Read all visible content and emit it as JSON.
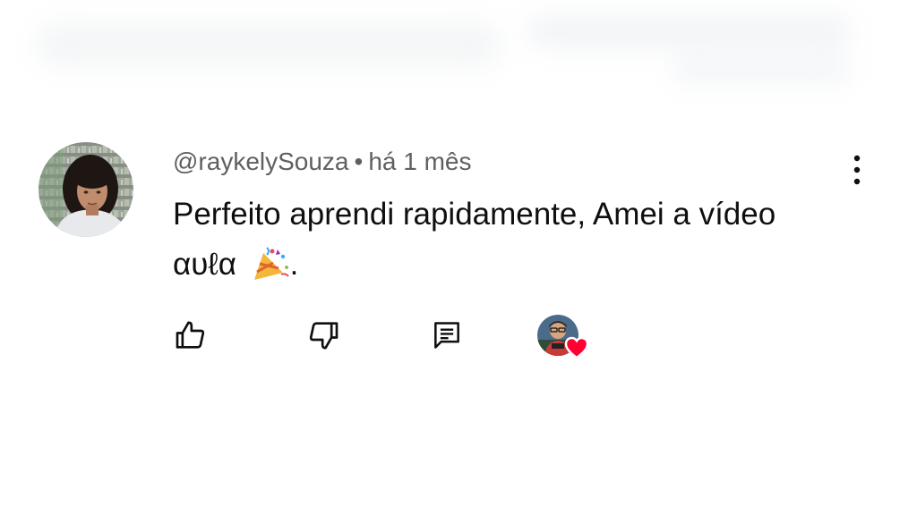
{
  "comment": {
    "username": "@raykelySouza",
    "separator": "•",
    "time_ago": "há 1 mês",
    "text_line1": "Perfeito aprendi rapidamente, Amei a vídeo",
    "text_line2_word": "αυℓα",
    "text_line2_end": ".",
    "emoji": "party-popper-emoji"
  },
  "actions": {
    "like_icon": "thumb-up-icon",
    "dislike_icon": "thumb-down-icon",
    "reply_icon": "comment-icon",
    "creator_heart": "creator-heart-icon"
  },
  "colors": {
    "text": "#0f0f0f",
    "meta": "#606060",
    "heart": "#ff0033"
  }
}
